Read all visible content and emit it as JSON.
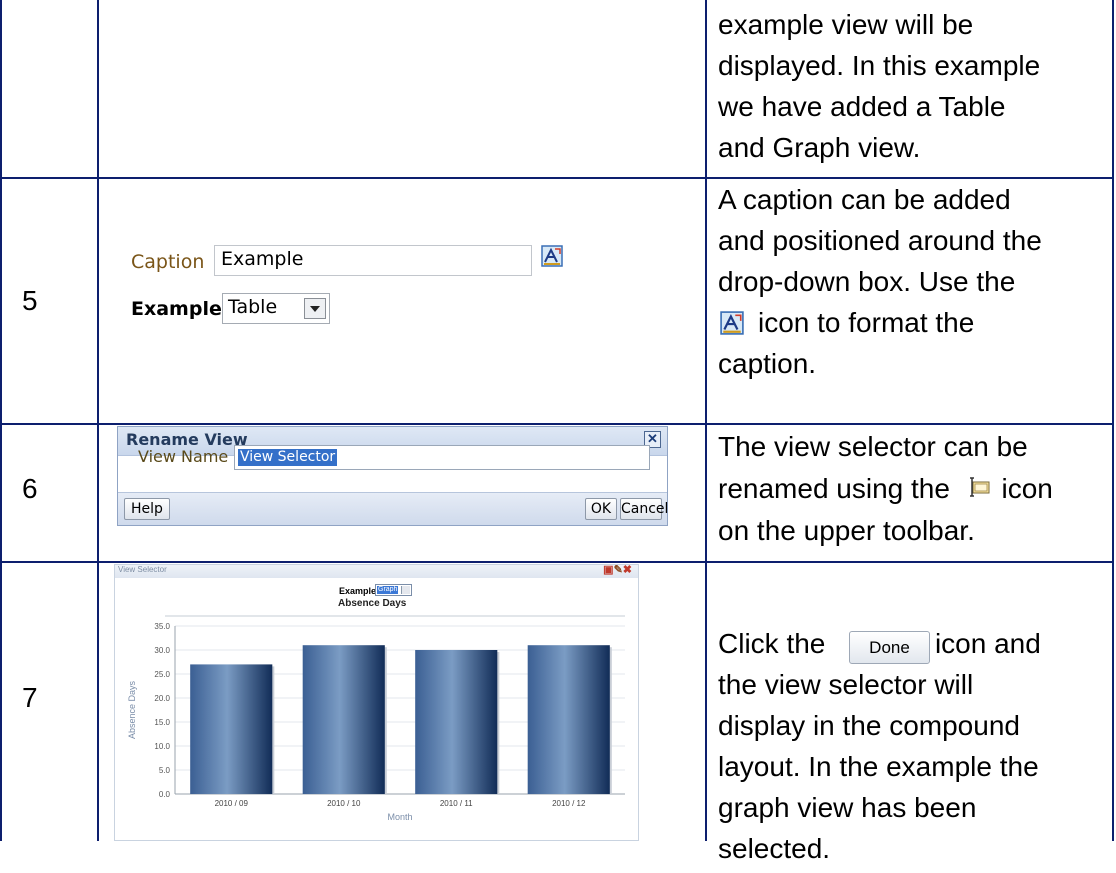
{
  "row4": {
    "text_lines": [
      "example view will be",
      "displayed. In this example",
      "we have added a Table",
      "and Graph view."
    ]
  },
  "row5": {
    "number": "5",
    "caption_label": "Caption",
    "caption_value": "Example",
    "example_label": "Example",
    "example_selected": "Table",
    "text_lines": [
      "A caption can be added",
      "and positioned around the",
      "drop-down box.  Use the",
      "icon to format the",
      "caption."
    ]
  },
  "row6": {
    "number": "6",
    "dialog_title": "Rename View",
    "view_name_label": "View Name",
    "view_name_value": "View Selector",
    "help_label": "Help",
    "ok_label": "OK",
    "cancel_label": "Cancel",
    "text_lines": [
      "The view selector can be",
      "renamed using the",
      "icon",
      "on the upper toolbar."
    ]
  },
  "row7": {
    "number": "7",
    "panel_title": "View Selector",
    "selector_label": "Example",
    "selector_value": "Graph",
    "done_label": "Done",
    "text_lines": [
      "Click the",
      "icon and",
      "the view selector will",
      "display in the compound",
      "layout.  In the example the",
      "graph view has been",
      "selected."
    ]
  },
  "chart_data": {
    "type": "bar",
    "title": "Absence Days",
    "xlabel": "Month",
    "ylabel": "Absence Days",
    "categories": [
      "2010 / 09",
      "2010 / 10",
      "2010 / 11",
      "2010 / 12"
    ],
    "values": [
      27,
      31,
      30,
      31
    ],
    "ylim": [
      0,
      35
    ],
    "yticks": [
      "0.0",
      "5.0",
      "10.0",
      "15.0",
      "20.0",
      "25.0",
      "30.0",
      "35.0"
    ],
    "bar_color": "#1f3f6e",
    "grid": true
  }
}
